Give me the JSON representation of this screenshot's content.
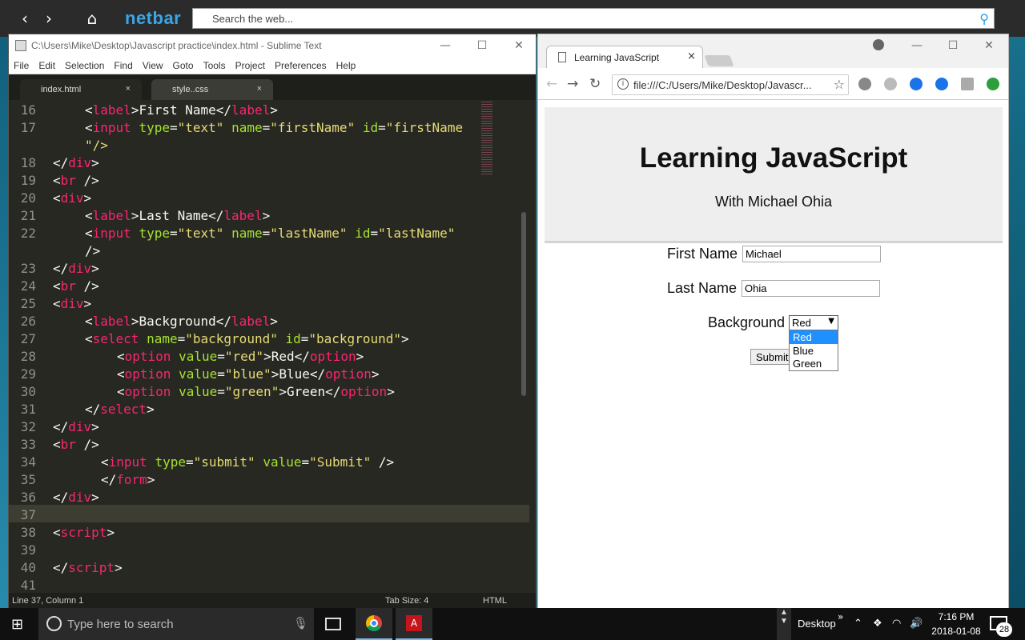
{
  "netbar": {
    "back_icon": "chevron-left-icon",
    "forward_icon": "chevron-right-icon",
    "home_icon": "home-icon",
    "logo": "netbar",
    "search_placeholder": "Search the web...",
    "accent_color": "#3aa6e8"
  },
  "sublime": {
    "title": "C:\\Users\\Mike\\Desktop\\Javascript practice\\index.html - Sublime Text",
    "menu": [
      "File",
      "Edit",
      "Selection",
      "Find",
      "View",
      "Goto",
      "Tools",
      "Project",
      "Preferences",
      "Help"
    ],
    "tabs": [
      {
        "label": "index.html",
        "close": "×",
        "active": true
      },
      {
        "label": "style..css",
        "close": "×",
        "active": false
      }
    ],
    "line_numbers": [
      "16",
      "17",
      "",
      "18",
      "19",
      "20",
      "21",
      "22",
      "",
      "23",
      "24",
      "25",
      "26",
      "27",
      "28",
      "29",
      "30",
      "31",
      "32",
      "33",
      "34",
      "35",
      "36",
      "37",
      "38",
      "39",
      "40",
      "41"
    ],
    "code": {
      "l16": [
        "<",
        "label",
        ">First Name</",
        "label",
        ">"
      ],
      "l17": [
        "<",
        "input",
        " ",
        "type",
        "=",
        "\"text\"",
        " ",
        "name",
        "=",
        "\"firstName\"",
        " ",
        "id",
        "=",
        "\"firstName"
      ],
      "l17b": [
        "\"/>"
      ],
      "l18": [
        "</",
        "div",
        ">"
      ],
      "l19": [
        "<",
        "br",
        " />"
      ],
      "l20": [
        "<",
        "div",
        ">"
      ],
      "l21": [
        "<",
        "label",
        ">Last Name</",
        "label",
        ">"
      ],
      "l22": [
        "<",
        "input",
        " ",
        "type",
        "=",
        "\"text\"",
        " ",
        "name",
        "=",
        "\"lastName\"",
        " ",
        "id",
        "=",
        "\"lastName\""
      ],
      "l22b": [
        "/>"
      ],
      "l23": [
        "</",
        "div",
        ">"
      ],
      "l24": [
        "<",
        "br",
        " />"
      ],
      "l25": [
        "<",
        "div",
        ">"
      ],
      "l26": [
        "<",
        "label",
        ">Background</",
        "label",
        ">"
      ],
      "l27": [
        "<",
        "select",
        " ",
        "name",
        "=",
        "\"background\"",
        " ",
        "id",
        "=",
        "\"background\"",
        ">"
      ],
      "l28": [
        "<",
        "option",
        " ",
        "value",
        "=",
        "\"red\"",
        ">Red</",
        "option",
        ">"
      ],
      "l29": [
        "<",
        "option",
        " ",
        "value",
        "=",
        "\"blue\"",
        ">Blue</",
        "option",
        ">"
      ],
      "l30": [
        "<",
        "option",
        " ",
        "value",
        "=",
        "\"green\"",
        ">Green</",
        "option",
        ">"
      ],
      "l31": [
        "</",
        "select",
        ">"
      ],
      "l32": [
        "</",
        "div",
        ">"
      ],
      "l33": [
        "<",
        "br",
        " />"
      ],
      "l34": [
        "<",
        "input",
        " ",
        "type",
        "=",
        "\"submit\"",
        " ",
        "value",
        "=",
        "\"Submit\"",
        " />"
      ],
      "l35": [
        "</",
        "form",
        ">"
      ],
      "l36": [
        "</",
        "div",
        ">"
      ],
      "l38": [
        "<",
        "script",
        ">"
      ],
      "l40": [
        "</",
        "script",
        ">"
      ]
    },
    "status_left": "Line 37, Column 1",
    "status_tab": "Tab Size: 4",
    "status_syntax": "HTML",
    "colors": {
      "background": "#272822",
      "tag": "#f92672",
      "attr": "#a6e22e",
      "string": "#e6db74",
      "text": "#f8f8f2"
    }
  },
  "chrome": {
    "tab_title": "Learning JavaScript",
    "tab_close": "×",
    "url": "file:///C:/Users/Mike/Desktop/Javascr...",
    "page": {
      "title": "Learning JavaScript",
      "subtitle": "With Michael Ohia",
      "first_name_label": "First Name",
      "first_name_value": "Michael",
      "last_name_label": "Last Name",
      "last_name_value": "Ohia",
      "background_label": "Background",
      "select_value": "Red",
      "select_arrow": "▼",
      "options": [
        "Red",
        "Blue",
        "Green"
      ],
      "highlighted_option": "Red",
      "submit_label": "Submit"
    }
  },
  "taskbar": {
    "search_placeholder": "Type here to search",
    "pdf_label": "A",
    "desktop_label": "Desktop",
    "time": "7:16 PM",
    "date": "2018-01-08",
    "notification_count": "28"
  }
}
